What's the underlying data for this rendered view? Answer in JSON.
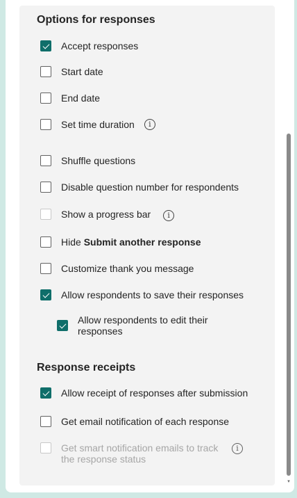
{
  "sections": {
    "options_title": "Options for responses",
    "receipts_title": "Response receipts"
  },
  "options": [
    {
      "label": "Accept responses",
      "checked": true
    },
    {
      "label": "Start date",
      "checked": false
    },
    {
      "label": "End date",
      "checked": false
    },
    {
      "label": "Set time duration",
      "checked": false,
      "info": true
    },
    {
      "label": "Shuffle questions",
      "checked": false
    },
    {
      "label": "Disable question number for respondents",
      "checked": false
    },
    {
      "label": "Show a progress bar",
      "checked": false,
      "info": true,
      "disabled_checkbox": true
    },
    {
      "label_prefix": "Hide ",
      "label_bold": "Submit another response",
      "checked": false
    },
    {
      "label": "Customize thank you message",
      "checked": false
    },
    {
      "label": "Allow respondents to save their responses",
      "checked": true
    },
    {
      "label": "Allow respondents to edit their responses",
      "checked": true
    }
  ],
  "receipts": [
    {
      "label": "Allow receipt of responses after submission",
      "checked": true
    },
    {
      "label": "Get email notification of each response",
      "checked": false
    },
    {
      "label": "Get smart notification emails to track the response status",
      "checked": false,
      "disabled": true,
      "info": true
    }
  ],
  "icons": {
    "info": "i",
    "scroll_down": "▾"
  },
  "colors": {
    "accent": "#0f6e6a",
    "card_bg": "#f3f3f3",
    "page_bg": "#cfe9e4"
  }
}
